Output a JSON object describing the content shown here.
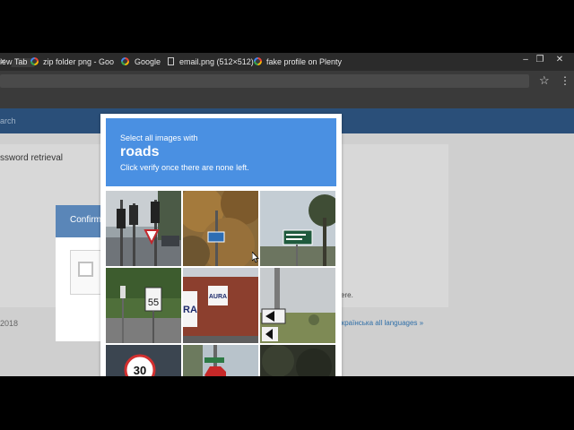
{
  "browser": {
    "window_controls": {
      "minimize": "–",
      "maximize": "❐",
      "close": "✕"
    },
    "tab_close": "×",
    "bookmarks": [
      {
        "label": "iew Tab",
        "icon": "none"
      },
      {
        "label": "zip folder png - Goo",
        "icon": "google-icon"
      },
      {
        "label": "Google",
        "icon": "google-icon"
      },
      {
        "label": "email.png (512×512)",
        "icon": "page-icon"
      },
      {
        "label": "fake profile on Plenty",
        "icon": "google-icon"
      }
    ]
  },
  "page": {
    "search_placeholder": "arch",
    "section_title": "ssword retrieval",
    "confirm_label": "Confirm",
    "copyright": "2018",
    "help_text": "ere.",
    "languages": "Українська  all languages »"
  },
  "captcha": {
    "instruction": "Select all images with",
    "keyword": "roads",
    "hint": "Click verify once there are none left.",
    "accent": "#4a90e2",
    "tiles": [
      {
        "id": "traffic-lights"
      },
      {
        "id": "autumn-sign"
      },
      {
        "id": "green-road-sign"
      },
      {
        "id": "speed-55-sign"
      },
      {
        "id": "brick-building-sign"
      },
      {
        "id": "arrow-sign"
      },
      {
        "id": "speed-30-sign"
      },
      {
        "id": "stop-sign"
      },
      {
        "id": "dark-foliage"
      }
    ],
    "tile_text": {
      "speed_55": "55",
      "speed_30": "30",
      "aura": "AURA",
      "ra": "RA"
    }
  }
}
